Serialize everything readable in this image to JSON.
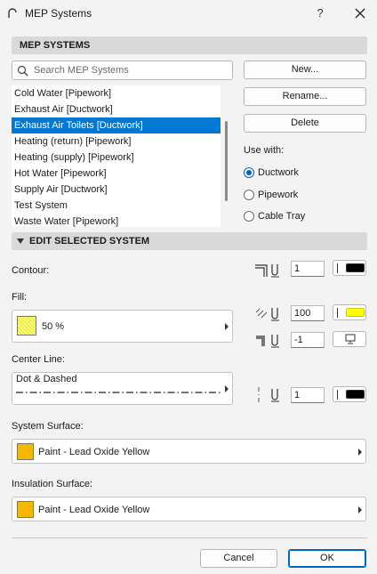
{
  "window": {
    "title": "MEP Systems",
    "help_label": "?"
  },
  "mep_systems": {
    "header": "MEP SYSTEMS",
    "search_placeholder": "Search MEP Systems",
    "items": [
      {
        "label": "Cold Water [Pipework]",
        "selected": false
      },
      {
        "label": "Exhaust Air [Ductwork]",
        "selected": false
      },
      {
        "label": "Exhaust Air Toilets [Ductwork]",
        "selected": true
      },
      {
        "label": "Heating (return) [Pipework]",
        "selected": false
      },
      {
        "label": "Heating (supply) [Pipework]",
        "selected": false
      },
      {
        "label": "Hot Water [Pipework]",
        "selected": false
      },
      {
        "label": "Supply Air [Ductwork]",
        "selected": false
      },
      {
        "label": "Test System",
        "selected": false
      },
      {
        "label": "Waste Water [Pipework]",
        "selected": false
      }
    ],
    "buttons": {
      "new": "New...",
      "rename": "Rename...",
      "delete": "Delete"
    },
    "use_with": {
      "label": "Use with:",
      "options": [
        {
          "label": "Ductwork",
          "checked": true
        },
        {
          "label": "Pipework",
          "checked": false
        },
        {
          "label": "Cable Tray",
          "checked": false
        }
      ]
    }
  },
  "edit_system": {
    "header": "EDIT SELECTED SYSTEM",
    "contour": {
      "label": "Contour:",
      "pen_value": "1",
      "pen_color": "#000000"
    },
    "fill": {
      "label": "Fill:",
      "pattern_label": "50 %",
      "swatch_color": "#ffff66",
      "fg_pen_value": "100",
      "fg_pen_color": "#ffff00",
      "bg_pen_value": "-1"
    },
    "center_line": {
      "label": "Center Line:",
      "line_type": "Dot & Dashed",
      "pen_value": "1",
      "pen_color": "#000000"
    },
    "system_surface": {
      "label": "System Surface:",
      "value": "Paint - Lead Oxide Yellow",
      "swatch_color": "#f5b800"
    },
    "insulation_surface": {
      "label": "Insulation Surface:",
      "value": "Paint - Lead Oxide Yellow",
      "swatch_color": "#f5b800"
    }
  },
  "footer": {
    "cancel": "Cancel",
    "ok": "OK"
  },
  "colors": {
    "accent": "#0078d4",
    "section_bg": "#d9d9d9"
  }
}
